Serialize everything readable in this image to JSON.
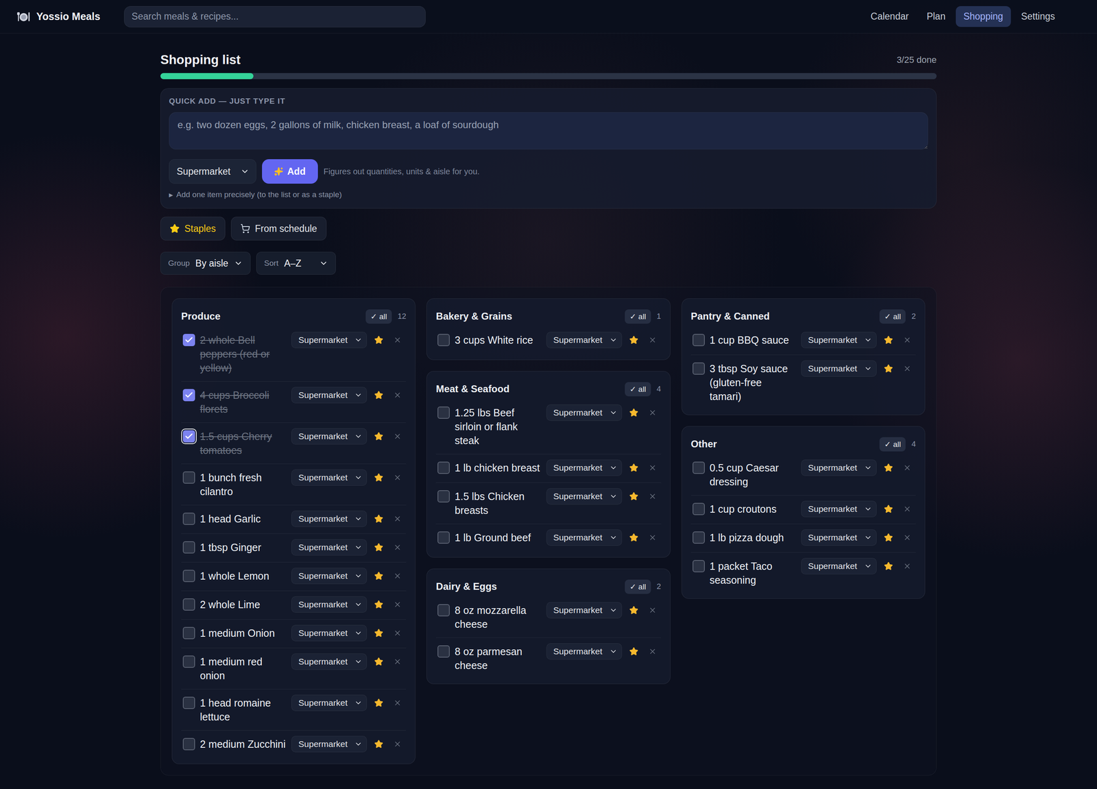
{
  "app": {
    "title": "Yossio Meals"
  },
  "search": {
    "placeholder": "Search meals & recipes..."
  },
  "nav": [
    {
      "label": "Calendar",
      "selected": false
    },
    {
      "label": "Plan",
      "selected": false
    },
    {
      "label": "Shopping",
      "selected": true
    },
    {
      "label": "Settings",
      "selected": false
    }
  ],
  "header": {
    "title": "Shopping list",
    "done": "3/25 done",
    "level": 0.12
  },
  "quick_add": {
    "label": "QUICK ADD — JUST TYPE IT",
    "placeholder": "e.g. two dozen eggs, 2 gallons of milk, chicken breast, a loaf of sourdough",
    "store": "Supermarket",
    "button": "Add",
    "hint": "Figures out quantities, units & aisle for you.",
    "disclosure_marker": "▶",
    "disclosure": "Add one item precisely (to the list or as a staple)"
  },
  "actions": [
    {
      "label": "Staples",
      "kind": "staples"
    },
    {
      "label": "From schedule",
      "kind": "schedule"
    }
  ],
  "controls": [
    {
      "label": "Group",
      "value": "By aisle"
    },
    {
      "label": "Sort",
      "value": "A–Z"
    }
  ],
  "columns": [
    {
      "groups": [
        {
          "title": "Produce",
          "check_all": "✓ all",
          "count": "12",
          "items": [
            {
              "text": "2 whole Bell peppers (red or yellow)",
              "checked": true,
              "focused": false,
              "store": "Supermarket",
              "staple": true
            },
            {
              "text": "4 cups Broccoli florets",
              "checked": true,
              "focused": false,
              "store": "Supermarket",
              "staple": true
            },
            {
              "text": "1.5 cups Cherry tomatoes",
              "checked": true,
              "focused": true,
              "store": "Supermarket",
              "staple": true
            },
            {
              "text": "1 bunch fresh cilantro",
              "checked": false,
              "focused": false,
              "store": "Supermarket",
              "staple": true
            },
            {
              "text": "1 head Garlic",
              "checked": false,
              "focused": false,
              "store": "Supermarket",
              "staple": true
            },
            {
              "text": "1 tbsp Ginger",
              "checked": false,
              "focused": false,
              "store": "Supermarket",
              "staple": true
            },
            {
              "text": "1 whole Lemon",
              "checked": false,
              "focused": false,
              "store": "Supermarket",
              "staple": true
            },
            {
              "text": "2 whole Lime",
              "checked": false,
              "focused": false,
              "store": "Supermarket",
              "staple": true
            },
            {
              "text": "1 medium Onion",
              "checked": false,
              "focused": false,
              "store": "Supermarket",
              "staple": true
            },
            {
              "text": "1 medium red onion",
              "checked": false,
              "focused": false,
              "store": "Supermarket",
              "staple": true
            },
            {
              "text": "1 head romaine lettuce",
              "checked": false,
              "focused": false,
              "store": "Supermarket",
              "staple": true
            },
            {
              "text": "2 medium Zucchini",
              "checked": false,
              "focused": false,
              "store": "Supermarket",
              "staple": true
            }
          ]
        }
      ]
    },
    {
      "groups": [
        {
          "title": "Bakery & Grains",
          "check_all": "✓ all",
          "count": "1",
          "items": [
            {
              "text": "3 cups White rice",
              "checked": false,
              "focused": false,
              "store": "Supermarket",
              "staple": true
            }
          ]
        },
        {
          "title": "Meat & Seafood",
          "check_all": "✓ all",
          "count": "4",
          "items": [
            {
              "text": "1.25 lbs Beef sirloin or flank steak",
              "checked": false,
              "focused": false,
              "store": "Supermarket",
              "staple": true
            },
            {
              "text": "1 lb chicken breast",
              "checked": false,
              "focused": false,
              "store": "Supermarket",
              "staple": true
            },
            {
              "text": "1.5 lbs Chicken breasts",
              "checked": false,
              "focused": false,
              "store": "Supermarket",
              "staple": true
            },
            {
              "text": "1 lb Ground beef",
              "checked": false,
              "focused": false,
              "store": "Supermarket",
              "staple": true
            }
          ]
        },
        {
          "title": "Dairy & Eggs",
          "check_all": "✓ all",
          "count": "2",
          "items": [
            {
              "text": "8 oz mozzarella cheese",
              "checked": false,
              "focused": false,
              "store": "Supermarket",
              "staple": true
            },
            {
              "text": "8 oz parmesan cheese",
              "checked": false,
              "focused": false,
              "store": "Supermarket",
              "staple": true
            }
          ]
        }
      ]
    },
    {
      "groups": [
        {
          "title": "Pantry & Canned",
          "check_all": "✓ all",
          "count": "2",
          "items": [
            {
              "text": "1 cup BBQ sauce",
              "checked": false,
              "focused": false,
              "store": "Supermarket",
              "staple": true
            },
            {
              "text": "3 tbsp Soy sauce (gluten-free tamari)",
              "checked": false,
              "focused": false,
              "store": "Supermarket",
              "staple": true
            }
          ]
        },
        {
          "title": "Other",
          "check_all": "✓ all",
          "count": "4",
          "items": [
            {
              "text": "0.5 cup Caesar dressing",
              "checked": false,
              "focused": false,
              "store": "Supermarket",
              "staple": true
            },
            {
              "text": "1 cup croutons",
              "checked": false,
              "focused": false,
              "store": "Supermarket",
              "staple": true
            },
            {
              "text": "1 lb pizza dough",
              "checked": false,
              "focused": false,
              "store": "Supermarket",
              "staple": true
            },
            {
              "text": "1 packet Taco seasoning",
              "checked": false,
              "focused": false,
              "store": "Supermarket",
              "staple": true
            }
          ]
        }
      ]
    }
  ]
}
